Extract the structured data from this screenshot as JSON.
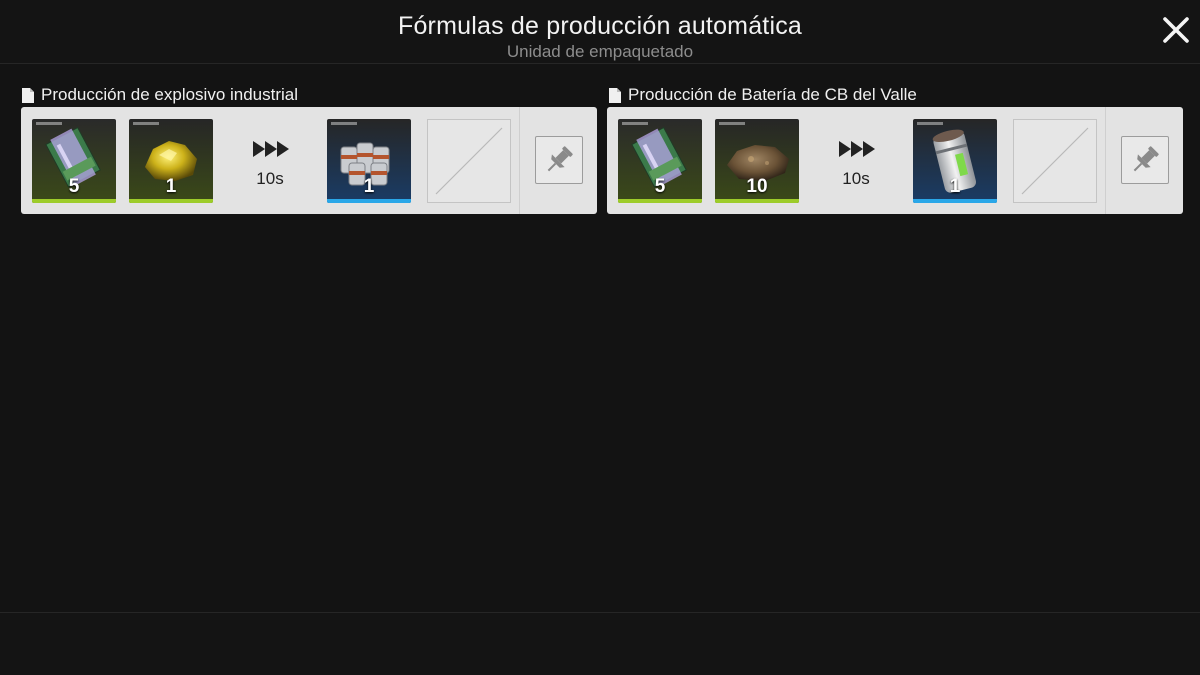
{
  "header": {
    "title": "Fórmulas de producción automática",
    "subtitle": "Unidad de empaquetado"
  },
  "formulas": [
    {
      "title": "Producción de explosivo industrial",
      "inputs": [
        {
          "icon": "circuit-board-icon",
          "quantity": "5",
          "rarity_color": "#9dcc2a"
        },
        {
          "icon": "gold-ore-icon",
          "quantity": "1",
          "rarity_color": "#9dcc2a"
        }
      ],
      "time": "10s",
      "output": {
        "icon": "industrial-explosive-icon",
        "quantity": "1",
        "rarity_color": "#2aa7e8"
      }
    },
    {
      "title": "Producción de Batería de CB del Valle",
      "inputs": [
        {
          "icon": "circuit-board-icon",
          "quantity": "5",
          "rarity_color": "#9dcc2a"
        },
        {
          "icon": "ore-chunk-icon",
          "quantity": "10",
          "rarity_color": "#9dcc2a"
        }
      ],
      "time": "10s",
      "output": {
        "icon": "valley-battery-icon",
        "quantity": "1",
        "rarity_color": "#2aa7e8"
      }
    }
  ]
}
